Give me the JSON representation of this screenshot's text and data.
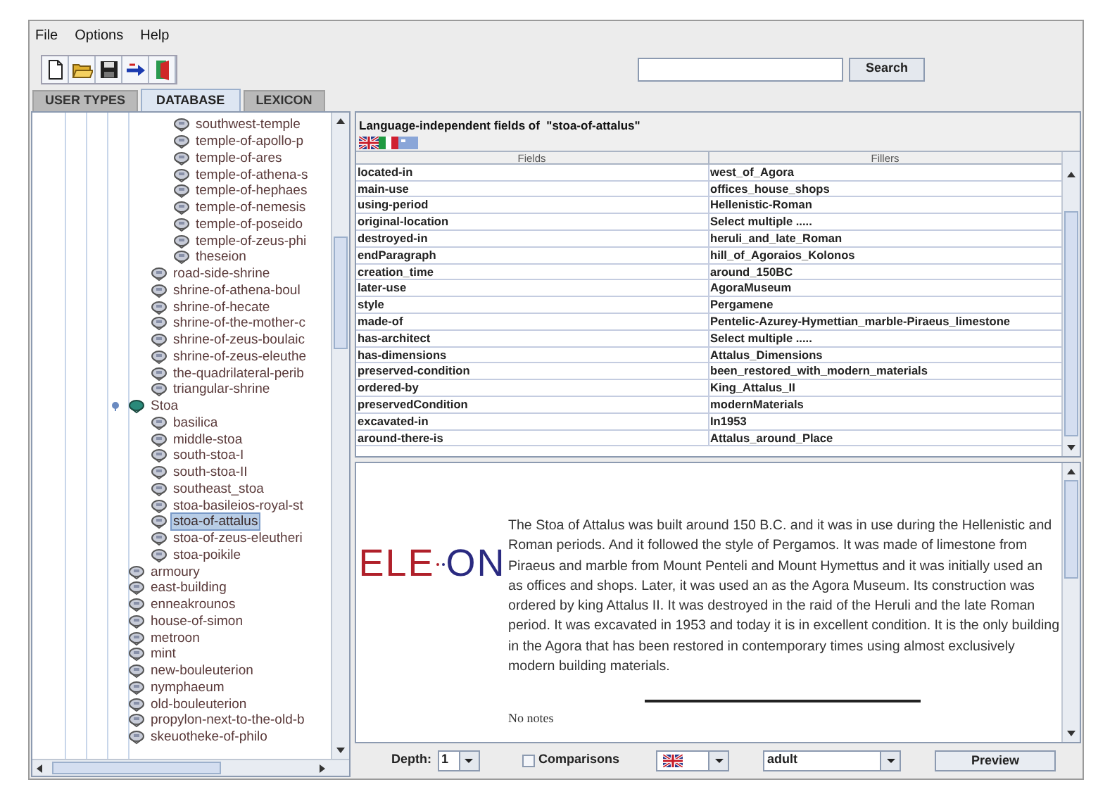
{
  "menu": [
    {
      "label": "File"
    },
    {
      "label": "Options"
    },
    {
      "label": "Help"
    }
  ],
  "toolbar": [
    {
      "kind": "new"
    },
    {
      "kind": "open"
    },
    {
      "kind": "save"
    },
    {
      "kind": "arrow"
    },
    {
      "kind": "exit"
    }
  ],
  "search": {
    "button": "Search"
  },
  "tabs": [
    {
      "label": "USER TYPES",
      "selected": false
    },
    {
      "label": "DATABASE",
      "selected": true
    },
    {
      "label": "LEXICON",
      "selected": false
    }
  ],
  "tree": [
    {
      "children": [
        {
          "children": [
            {
              "label": "southwest-temple",
              "kind": "leaf",
              "selected": false
            },
            {
              "label": "temple-of-apollo-p",
              "kind": "leaf",
              "selected": false
            },
            {
              "label": "temple-of-ares",
              "kind": "leaf",
              "selected": false
            },
            {
              "label": "temple-of-athena-s",
              "kind": "leaf",
              "selected": false
            },
            {
              "label": "temple-of-hephaes",
              "kind": "leaf",
              "selected": false
            },
            {
              "label": "temple-of-nemesis",
              "kind": "leaf",
              "selected": false
            },
            {
              "label": "temple-of-poseido",
              "kind": "leaf",
              "selected": false
            },
            {
              "label": "temple-of-zeus-phi",
              "kind": "leaf",
              "selected": false
            },
            {
              "label": "theseion",
              "kind": "leaf",
              "selected": false
            }
          ]
        },
        {
          "label": "road-side-shrine",
          "kind": "leaf",
          "selected": false
        },
        {
          "label": "shrine-of-athena-boul",
          "kind": "leaf",
          "selected": false
        },
        {
          "label": "shrine-of-hecate",
          "kind": "leaf",
          "selected": false
        },
        {
          "label": "shrine-of-the-mother-c",
          "kind": "leaf",
          "selected": false
        },
        {
          "label": "shrine-of-zeus-boulaic",
          "kind": "leaf",
          "selected": false
        },
        {
          "label": "shrine-of-zeus-eleuthe",
          "kind": "leaf",
          "selected": false
        },
        {
          "label": "the-quadrilateral-perib",
          "kind": "leaf",
          "selected": false
        },
        {
          "label": "triangular-shrine",
          "kind": "leaf",
          "selected": false
        }
      ]
    },
    {
      "label": "Stoa",
      "kind": "folder",
      "expanded": true,
      "selected": false,
      "children": [
        {
          "label": "basilica",
          "kind": "leaf",
          "selected": false
        },
        {
          "label": "middle-stoa",
          "kind": "leaf",
          "selected": false
        },
        {
          "label": "south-stoa-I",
          "kind": "leaf",
          "selected": false
        },
        {
          "label": "south-stoa-II",
          "kind": "leaf",
          "selected": false
        },
        {
          "label": "southeast_stoa",
          "kind": "leaf",
          "selected": false
        },
        {
          "label": "stoa-basileios-royal-st",
          "kind": "leaf",
          "selected": false
        },
        {
          "label": "stoa-of-attalus",
          "kind": "leaf",
          "selected": true
        },
        {
          "label": "stoa-of-zeus-eleutheri",
          "kind": "leaf",
          "selected": false
        },
        {
          "label": "stoa-poikile",
          "kind": "leaf",
          "selected": false
        }
      ]
    },
    {
      "label": "armoury",
      "kind": "leaf",
      "selected": false
    },
    {
      "label": "east-building",
      "kind": "leaf",
      "selected": false
    },
    {
      "label": "enneakrounos",
      "kind": "leaf",
      "selected": false
    },
    {
      "label": "house-of-simon",
      "kind": "leaf",
      "selected": false
    },
    {
      "label": "metroon",
      "kind": "leaf",
      "selected": false
    },
    {
      "label": "mint",
      "kind": "leaf",
      "selected": false
    },
    {
      "label": "new-bouleuterion",
      "kind": "leaf",
      "selected": false
    },
    {
      "label": "nymphaeum",
      "kind": "leaf",
      "selected": false
    },
    {
      "label": "old-bouleuterion",
      "kind": "leaf",
      "selected": false
    },
    {
      "label": "propylon-next-to-the-old-b",
      "kind": "leaf",
      "selected": false
    },
    {
      "label": "skeuotheke-of-philo",
      "kind": "leaf",
      "selected": false
    }
  ],
  "fields_panel": {
    "title": "Language-independent fields of  \"stoa-of-attalus\"",
    "flags": [
      {
        "kind": "uk"
      },
      {
        "kind": "italy"
      },
      {
        "kind": "blue"
      }
    ],
    "columns": [
      "Fields",
      "Fillers"
    ],
    "rows": [
      [
        "located-in",
        "west_of_Agora"
      ],
      [
        "main-use",
        "offices_house_shops"
      ],
      [
        "using-period",
        "Hellenistic-Roman"
      ],
      [
        "original-location",
        "Select multiple ....."
      ],
      [
        "destroyed-in",
        "heruli_and_late_Roman"
      ],
      [
        "endParagraph",
        "hill_of_Agoraios_Kolonos"
      ],
      [
        "creation_time",
        "around_150BC"
      ],
      [
        "later-use",
        "AgoraMuseum"
      ],
      [
        "style",
        "Pergamene"
      ],
      [
        "made-of",
        "Pentelic-Azurey-Hymettian_marble-Piraeus_limestone"
      ],
      [
        "has-architect",
        "Select multiple ....."
      ],
      [
        "has-dimensions",
        "Attalus_Dimensions"
      ],
      [
        "preserved-condition",
        "been_restored_with_modern_materials"
      ],
      [
        "ordered-by",
        "King_Attalus_II"
      ],
      [
        "preservedCondition",
        "modernMaterials"
      ],
      [
        "excavated-in",
        "In1953"
      ],
      [
        "around-there-is",
        "Attalus_around_Place"
      ]
    ]
  },
  "preview": {
    "logo_left": "ELE",
    "logo_right": "ON",
    "text": "The Stoa of Attalus was built around 150 B.C. and it was in use during the Hellenistic and Roman periods. And it followed the style of Pergamos. It was made of limestone from Piraeus and marble from Mount Penteli and Mount Hymettus and it was initially used an as offices and shops. Later, it was used an as the Agora Museum. Its construction was ordered by king Attalus II. It was destroyed in the raid of the Heruli and the late Roman period. It was excavated in 1953 and today it is in excellent condition. It is the only building in the Agora that has been restored in contemporary times using almost exclusively modern building materials.",
    "notes": "No notes"
  },
  "bottom_bar": {
    "depth_label": "Depth:",
    "depth": "1",
    "comparisons": {
      "label": "Comparisons",
      "checked": false
    },
    "language": {
      "kind": "uk"
    },
    "audience": "adult",
    "button": "Preview"
  }
}
